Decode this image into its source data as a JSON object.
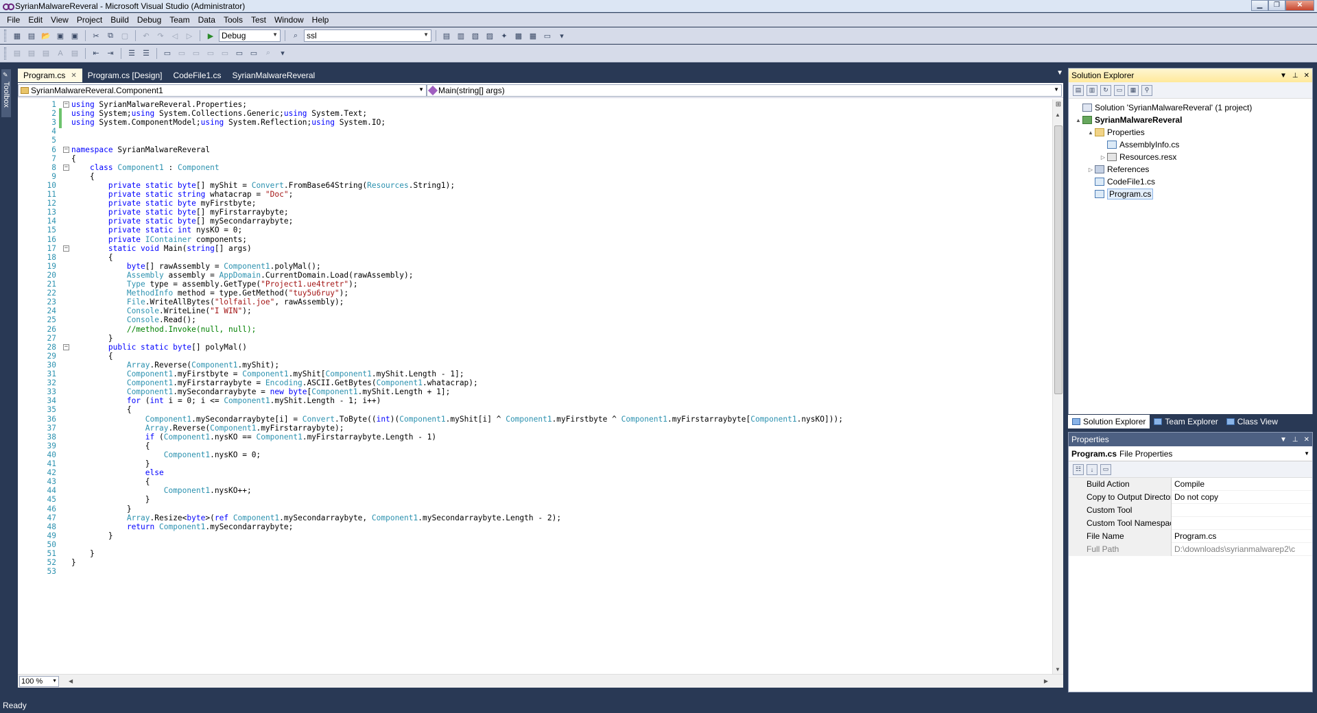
{
  "window": {
    "title": "SyrianMalwareReveral - Microsoft Visual Studio (Administrator)"
  },
  "menu": [
    "File",
    "Edit",
    "View",
    "Project",
    "Build",
    "Debug",
    "Team",
    "Data",
    "Tools",
    "Test",
    "Window",
    "Help"
  ],
  "toolbar": {
    "configuration": "Debug",
    "find_text": "ssl"
  },
  "toolbox": {
    "label": "Toolbox"
  },
  "tabs": [
    {
      "label": "Program.cs",
      "active": true
    },
    {
      "label": "Program.cs [Design]",
      "active": false
    },
    {
      "label": "CodeFile1.cs",
      "active": false
    },
    {
      "label": "SyrianMalwareReveral",
      "active": false
    }
  ],
  "editor": {
    "type_dropdown": "SyrianMalwareReveral.Component1",
    "member_dropdown": "Main(string[] args)",
    "zoom": "100 %",
    "lines": [
      {
        "n": "1",
        "tokens": [
          [
            "kw",
            "using"
          ],
          [
            "p",
            " SyrianMalwareReveral.Properties;"
          ]
        ],
        "fold": "minus",
        "chg": ""
      },
      {
        "n": "2",
        "tokens": [
          [
            "kw",
            "using"
          ],
          [
            "p",
            " System;"
          ],
          [
            "kw",
            "using"
          ],
          [
            "p",
            " System.Collections.Generic;"
          ],
          [
            "kw",
            "using"
          ],
          [
            "p",
            " System.Text;"
          ]
        ],
        "chg": "green"
      },
      {
        "n": "3",
        "tokens": [
          [
            "kw",
            "using"
          ],
          [
            "p",
            " System.ComponentModel;"
          ],
          [
            "kw",
            "using"
          ],
          [
            "p",
            " System.Reflection;"
          ],
          [
            "kw",
            "using"
          ],
          [
            "p",
            " System.IO;"
          ]
        ],
        "chg": "green"
      },
      {
        "n": "4",
        "tokens": []
      },
      {
        "n": "5",
        "tokens": []
      },
      {
        "n": "6",
        "tokens": [
          [
            "kw",
            "namespace"
          ],
          [
            "p",
            " SyrianMalwareReveral"
          ]
        ],
        "fold": "minus"
      },
      {
        "n": "7",
        "tokens": [
          [
            "p",
            "{"
          ]
        ]
      },
      {
        "n": "8",
        "tokens": [
          [
            "p",
            "    "
          ],
          [
            "kw",
            "class"
          ],
          [
            "p",
            " "
          ],
          [
            "ty",
            "Component1"
          ],
          [
            "p",
            " : "
          ],
          [
            "ty",
            "Component"
          ]
        ],
        "fold": "minus"
      },
      {
        "n": "9",
        "tokens": [
          [
            "p",
            "    {"
          ]
        ]
      },
      {
        "n": "10",
        "tokens": [
          [
            "p",
            "        "
          ],
          [
            "kw",
            "private static byte"
          ],
          [
            "p",
            "[] myShit = "
          ],
          [
            "ty",
            "Convert"
          ],
          [
            "p",
            ".FromBase64String("
          ],
          [
            "ty",
            "Resources"
          ],
          [
            "p",
            ".String1);"
          ]
        ]
      },
      {
        "n": "11",
        "tokens": [
          [
            "p",
            "        "
          ],
          [
            "kw",
            "private static string"
          ],
          [
            "p",
            " whatacrap = "
          ],
          [
            "str",
            "\"Doc\""
          ],
          [
            "p",
            ";"
          ]
        ]
      },
      {
        "n": "12",
        "tokens": [
          [
            "p",
            "        "
          ],
          [
            "kw",
            "private static byte"
          ],
          [
            "p",
            " myFirstbyte;"
          ]
        ]
      },
      {
        "n": "13",
        "tokens": [
          [
            "p",
            "        "
          ],
          [
            "kw",
            "private static byte"
          ],
          [
            "p",
            "[] myFirstarraybyte;"
          ]
        ]
      },
      {
        "n": "14",
        "tokens": [
          [
            "p",
            "        "
          ],
          [
            "kw",
            "private static byte"
          ],
          [
            "p",
            "[] mySecondarraybyte;"
          ]
        ]
      },
      {
        "n": "15",
        "tokens": [
          [
            "p",
            "        "
          ],
          [
            "kw",
            "private static int"
          ],
          [
            "p",
            " nysKO = 0;"
          ]
        ]
      },
      {
        "n": "16",
        "tokens": [
          [
            "p",
            "        "
          ],
          [
            "kw",
            "private"
          ],
          [
            "p",
            " "
          ],
          [
            "ty",
            "IContainer"
          ],
          [
            "p",
            " components;"
          ]
        ]
      },
      {
        "n": "17",
        "tokens": [
          [
            "p",
            "        "
          ],
          [
            "kw",
            "static void"
          ],
          [
            "p",
            " Main("
          ],
          [
            "kw",
            "string"
          ],
          [
            "p",
            "[] args)"
          ]
        ],
        "fold": "minus"
      },
      {
        "n": "18",
        "tokens": [
          [
            "p",
            "        {"
          ]
        ]
      },
      {
        "n": "19",
        "tokens": [
          [
            "p",
            "            "
          ],
          [
            "kw",
            "byte"
          ],
          [
            "p",
            "[] rawAssembly = "
          ],
          [
            "ty",
            "Component1"
          ],
          [
            "p",
            ".polyMal();"
          ]
        ]
      },
      {
        "n": "20",
        "tokens": [
          [
            "p",
            "            "
          ],
          [
            "ty",
            "Assembly"
          ],
          [
            "p",
            " assembly = "
          ],
          [
            "ty",
            "AppDomain"
          ],
          [
            "p",
            ".CurrentDomain.Load(rawAssembly);"
          ]
        ]
      },
      {
        "n": "21",
        "tokens": [
          [
            "p",
            "            "
          ],
          [
            "ty",
            "Type"
          ],
          [
            "p",
            " type = assembly.GetType("
          ],
          [
            "str",
            "\"Project1.ue4tretr\""
          ],
          [
            "p",
            ");"
          ]
        ]
      },
      {
        "n": "22",
        "tokens": [
          [
            "p",
            "            "
          ],
          [
            "ty",
            "MethodInfo"
          ],
          [
            "p",
            " method = type.GetMethod("
          ],
          [
            "str",
            "\"tuy5u6ruy\""
          ],
          [
            "p",
            ");"
          ]
        ]
      },
      {
        "n": "23",
        "tokens": [
          [
            "p",
            "            "
          ],
          [
            "ty",
            "File"
          ],
          [
            "p",
            ".WriteAllBytes("
          ],
          [
            "str",
            "\"lolfail.joe\""
          ],
          [
            "p",
            ", rawAssembly);"
          ]
        ]
      },
      {
        "n": "24",
        "tokens": [
          [
            "p",
            "            "
          ],
          [
            "ty",
            "Console"
          ],
          [
            "p",
            ".WriteLine("
          ],
          [
            "str",
            "\"I WIN\""
          ],
          [
            "p",
            ");"
          ]
        ]
      },
      {
        "n": "25",
        "tokens": [
          [
            "p",
            "            "
          ],
          [
            "ty",
            "Console"
          ],
          [
            "p",
            ".Read();"
          ]
        ]
      },
      {
        "n": "26",
        "tokens": [
          [
            "p",
            "            "
          ],
          [
            "cm",
            "//method.Invoke(null, null);"
          ]
        ]
      },
      {
        "n": "27",
        "tokens": [
          [
            "p",
            "        }"
          ]
        ]
      },
      {
        "n": "28",
        "tokens": [
          [
            "p",
            "        "
          ],
          [
            "kw",
            "public static byte"
          ],
          [
            "p",
            "[] polyMal()"
          ]
        ],
        "fold": "minus"
      },
      {
        "n": "29",
        "tokens": [
          [
            "p",
            "        {"
          ]
        ]
      },
      {
        "n": "30",
        "tokens": [
          [
            "p",
            "            "
          ],
          [
            "ty",
            "Array"
          ],
          [
            "p",
            ".Reverse("
          ],
          [
            "ty",
            "Component1"
          ],
          [
            "p",
            ".myShit);"
          ]
        ]
      },
      {
        "n": "31",
        "tokens": [
          [
            "p",
            "            "
          ],
          [
            "ty",
            "Component1"
          ],
          [
            "p",
            ".myFirstbyte = "
          ],
          [
            "ty",
            "Component1"
          ],
          [
            "p",
            ".myShit["
          ],
          [
            "ty",
            "Component1"
          ],
          [
            "p",
            ".myShit.Length - 1];"
          ]
        ]
      },
      {
        "n": "32",
        "tokens": [
          [
            "p",
            "            "
          ],
          [
            "ty",
            "Component1"
          ],
          [
            "p",
            ".myFirstarraybyte = "
          ],
          [
            "ty",
            "Encoding"
          ],
          [
            "p",
            ".ASCII.GetBytes("
          ],
          [
            "ty",
            "Component1"
          ],
          [
            "p",
            ".whatacrap);"
          ]
        ]
      },
      {
        "n": "33",
        "tokens": [
          [
            "p",
            "            "
          ],
          [
            "ty",
            "Component1"
          ],
          [
            "p",
            ".mySecondarraybyte = "
          ],
          [
            "kw",
            "new byte"
          ],
          [
            "p",
            "["
          ],
          [
            "ty",
            "Component1"
          ],
          [
            "p",
            ".myShit.Length + 1];"
          ]
        ]
      },
      {
        "n": "34",
        "tokens": [
          [
            "p",
            "            "
          ],
          [
            "kw",
            "for"
          ],
          [
            "p",
            " ("
          ],
          [
            "kw",
            "int"
          ],
          [
            "p",
            " i = 0; i <= "
          ],
          [
            "ty",
            "Component1"
          ],
          [
            "p",
            ".myShit.Length - 1; i++)"
          ]
        ]
      },
      {
        "n": "35",
        "tokens": [
          [
            "p",
            "            {"
          ]
        ]
      },
      {
        "n": "36",
        "tokens": [
          [
            "p",
            "                "
          ],
          [
            "ty",
            "Component1"
          ],
          [
            "p",
            ".mySecondarraybyte[i] = "
          ],
          [
            "ty",
            "Convert"
          ],
          [
            "p",
            ".ToByte(("
          ],
          [
            "kw",
            "int"
          ],
          [
            "p",
            ")("
          ],
          [
            "ty",
            "Component1"
          ],
          [
            "p",
            ".myShit[i] ^ "
          ],
          [
            "ty",
            "Component1"
          ],
          [
            "p",
            ".myFirstbyte ^ "
          ],
          [
            "ty",
            "Component1"
          ],
          [
            "p",
            ".myFirstarraybyte["
          ],
          [
            "ty",
            "Component1"
          ],
          [
            "p",
            ".nysKO]));"
          ]
        ]
      },
      {
        "n": "37",
        "tokens": [
          [
            "p",
            "                "
          ],
          [
            "ty",
            "Array"
          ],
          [
            "p",
            ".Reverse("
          ],
          [
            "ty",
            "Component1"
          ],
          [
            "p",
            ".myFirstarraybyte);"
          ]
        ]
      },
      {
        "n": "38",
        "tokens": [
          [
            "p",
            "                "
          ],
          [
            "kw",
            "if"
          ],
          [
            "p",
            " ("
          ],
          [
            "ty",
            "Component1"
          ],
          [
            "p",
            ".nysKO == "
          ],
          [
            "ty",
            "Component1"
          ],
          [
            "p",
            ".myFirstarraybyte.Length - 1)"
          ]
        ]
      },
      {
        "n": "39",
        "tokens": [
          [
            "p",
            "                {"
          ]
        ]
      },
      {
        "n": "40",
        "tokens": [
          [
            "p",
            "                    "
          ],
          [
            "ty",
            "Component1"
          ],
          [
            "p",
            ".nysKO = 0;"
          ]
        ]
      },
      {
        "n": "41",
        "tokens": [
          [
            "p",
            "                }"
          ]
        ]
      },
      {
        "n": "42",
        "tokens": [
          [
            "p",
            "                "
          ],
          [
            "kw",
            "else"
          ]
        ]
      },
      {
        "n": "43",
        "tokens": [
          [
            "p",
            "                {"
          ]
        ]
      },
      {
        "n": "44",
        "tokens": [
          [
            "p",
            "                    "
          ],
          [
            "ty",
            "Component1"
          ],
          [
            "p",
            ".nysKO++;"
          ]
        ]
      },
      {
        "n": "45",
        "tokens": [
          [
            "p",
            "                }"
          ]
        ]
      },
      {
        "n": "46",
        "tokens": [
          [
            "p",
            "            }"
          ]
        ]
      },
      {
        "n": "47",
        "tokens": [
          [
            "p",
            "            "
          ],
          [
            "ty",
            "Array"
          ],
          [
            "p",
            ".Resize<"
          ],
          [
            "kw",
            "byte"
          ],
          [
            "p",
            ">("
          ],
          [
            "kw",
            "ref"
          ],
          [
            "p",
            " "
          ],
          [
            "ty",
            "Component1"
          ],
          [
            "p",
            ".mySecondarraybyte, "
          ],
          [
            "ty",
            "Component1"
          ],
          [
            "p",
            ".mySecondarraybyte.Length - 2);"
          ]
        ]
      },
      {
        "n": "48",
        "tokens": [
          [
            "p",
            "            "
          ],
          [
            "kw",
            "return"
          ],
          [
            "p",
            " "
          ],
          [
            "ty",
            "Component1"
          ],
          [
            "p",
            ".mySecondarraybyte;"
          ]
        ]
      },
      {
        "n": "49",
        "tokens": [
          [
            "p",
            "        }"
          ]
        ]
      },
      {
        "n": "50",
        "tokens": []
      },
      {
        "n": "51",
        "tokens": [
          [
            "p",
            "    }"
          ]
        ]
      },
      {
        "n": "52",
        "tokens": [
          [
            "p",
            "}"
          ]
        ]
      },
      {
        "n": "53",
        "tokens": []
      }
    ]
  },
  "solution_explorer": {
    "title": "Solution Explorer",
    "tree": [
      {
        "label": "Solution 'SyrianMalwareReveral' (1 project)",
        "level": 0,
        "icon": "solution-icon",
        "exp": ""
      },
      {
        "label": "SyrianMalwareReveral",
        "level": 0,
        "icon": "project-icon",
        "exp": "▲",
        "bold": true
      },
      {
        "label": "Properties",
        "level": 1,
        "icon": "folder-icon",
        "exp": "▲"
      },
      {
        "label": "AssemblyInfo.cs",
        "level": 2,
        "icon": "cs-file-icon",
        "exp": ""
      },
      {
        "label": "Resources.resx",
        "level": 2,
        "icon": "resx-file-icon",
        "exp": "▷"
      },
      {
        "label": "References",
        "level": 1,
        "icon": "references-icon",
        "exp": "▷"
      },
      {
        "label": "CodeFile1.cs",
        "level": 1,
        "icon": "cs-file-icon",
        "exp": ""
      },
      {
        "label": "Program.cs",
        "level": 1,
        "icon": "cs-file-icon",
        "exp": "",
        "selected": true
      }
    ],
    "bottom_tabs": [
      "Solution Explorer",
      "Team Explorer",
      "Class View"
    ]
  },
  "properties": {
    "title": "Properties",
    "object_name": "Program.cs",
    "object_type": "File Properties",
    "rows": [
      {
        "name": "Build Action",
        "value": "Compile"
      },
      {
        "name": "Copy to Output Directory",
        "value": "Do not copy"
      },
      {
        "name": "Custom Tool",
        "value": ""
      },
      {
        "name": "Custom Tool Namespace",
        "value": ""
      },
      {
        "name": "File Name",
        "value": "Program.cs"
      },
      {
        "name": "Full Path",
        "value": "D:\\downloads\\syrianmalwarep2\\c",
        "readonly": true
      }
    ]
  },
  "status": {
    "text": "Ready"
  }
}
